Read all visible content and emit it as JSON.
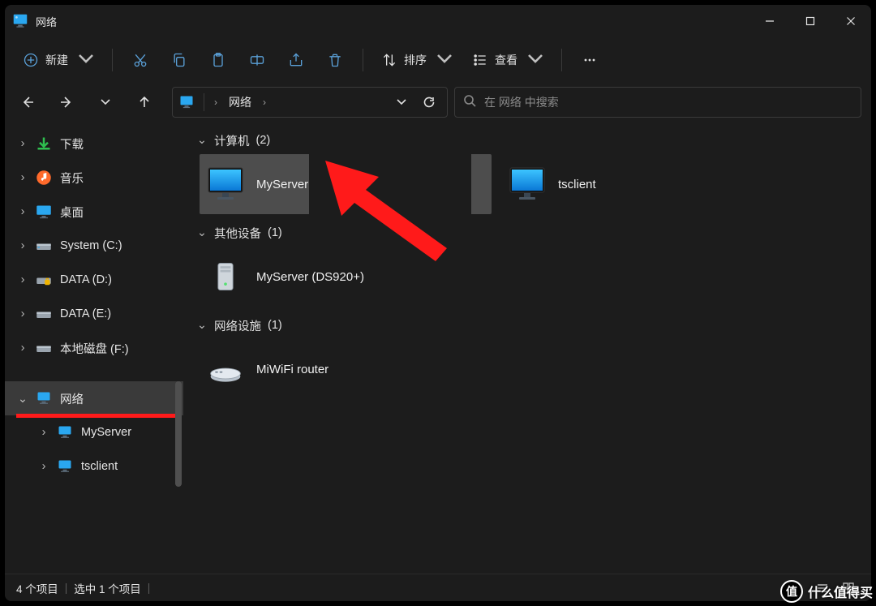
{
  "window": {
    "title": "网络"
  },
  "toolbar": {
    "new": "新建",
    "sort": "排序",
    "view": "查看"
  },
  "address": {
    "crumb": "网络"
  },
  "search": {
    "placeholder": "在 网络 中搜索"
  },
  "sidebar": {
    "downloads": "下载",
    "music": "音乐",
    "desktop": "桌面",
    "system_c": "System (C:)",
    "data_d": "DATA (D:)",
    "data_e": "DATA (E:)",
    "local_f": "本地磁盘 (F:)",
    "network": "网络",
    "myserver": "MyServer",
    "tsclient": "tsclient"
  },
  "groups": {
    "computers": {
      "label": "计算机",
      "count": "(2)"
    },
    "other_devices": {
      "label": "其他设备",
      "count": "(1)"
    },
    "network_infra": {
      "label": "网络设施",
      "count": "(1)"
    }
  },
  "items": {
    "myserver": "MyServer",
    "tsclient": "tsclient",
    "nas": "MyServer (DS920+)",
    "router": "MiWiFi router"
  },
  "status": {
    "count": "4 个项目",
    "selected": "选中 1 个项目"
  },
  "watermark": {
    "badge": "值",
    "text": "什么值得买"
  }
}
